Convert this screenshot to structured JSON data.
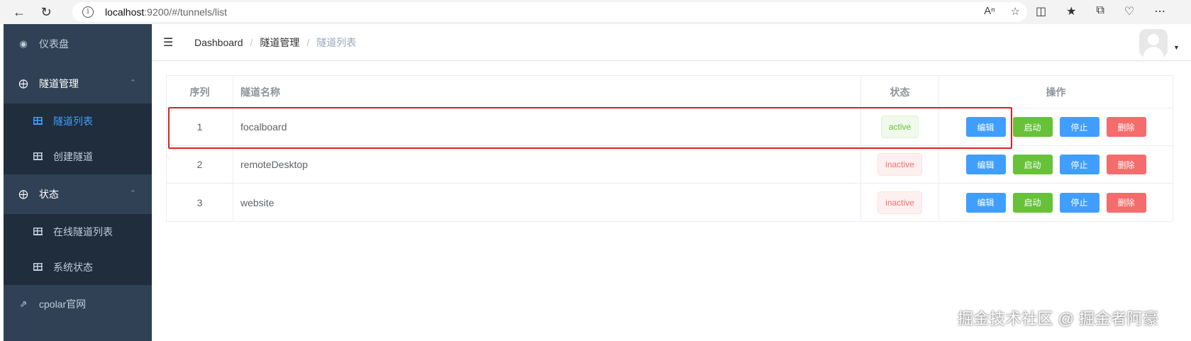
{
  "browser": {
    "host": "localhost",
    "path": ":9200/#/tunnels/list"
  },
  "sidebar": {
    "items": [
      {
        "label": "仪表盘",
        "icon": "dashboard-icon"
      },
      {
        "label": "隧道管理",
        "icon": "tunnel-manage-icon",
        "children": [
          {
            "label": "隧道列表",
            "icon": "table-icon",
            "active": true
          },
          {
            "label": "创建隧道",
            "icon": "table-icon"
          }
        ]
      },
      {
        "label": "状态",
        "icon": "status-icon",
        "children": [
          {
            "label": "在线隧道列表",
            "icon": "table-icon"
          },
          {
            "label": "系统状态",
            "icon": "table-icon"
          }
        ]
      },
      {
        "label": "cpolar官网",
        "icon": "external-link-icon"
      }
    ]
  },
  "breadcrumb": [
    "Dashboard",
    "隧道管理",
    "隧道列表"
  ],
  "table": {
    "headers": [
      "序列",
      "隧道名称",
      "状态",
      "操作"
    ],
    "rows": [
      {
        "idx": "1",
        "name": "focalboard",
        "status": "active"
      },
      {
        "idx": "2",
        "name": "remoteDesktop",
        "status": "inactive"
      },
      {
        "idx": "3",
        "name": "website",
        "status": "inactive"
      }
    ],
    "actions": {
      "edit": "编辑",
      "start": "启动",
      "stop": "停止",
      "delete": "删除"
    }
  },
  "watermark": "掘金技术社区 @ 掘金者阿豪",
  "colors": {
    "sidebar": "#304156",
    "submenu": "#1f2d3d",
    "primary": "#409eff",
    "success": "#67c23a",
    "danger": "#f56c6c",
    "highlight": "#e02020"
  }
}
